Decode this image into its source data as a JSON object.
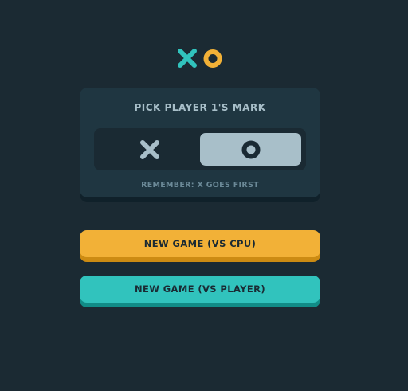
{
  "logo": {
    "x_icon": "x-mark-icon",
    "o_icon": "o-mark-icon",
    "x_color": "#31c3bd",
    "o_color": "#f2b137"
  },
  "mark_picker": {
    "title": "PICK PLAYER 1'S MARK",
    "options": [
      {
        "mark": "X",
        "icon": "x-mark-icon",
        "selected": false
      },
      {
        "mark": "O",
        "icon": "o-mark-icon",
        "selected": true
      }
    ],
    "note": "REMEMBER: X GOES FIRST"
  },
  "buttons": {
    "new_game_cpu": "NEW GAME (VS CPU)",
    "new_game_player": "NEW GAME (VS PLAYER)"
  },
  "colors": {
    "background": "#1b2a33",
    "panel": "#1f3641",
    "silver": "#a8bfc9",
    "yellow": "#f2b137",
    "teal": "#31c3bd"
  }
}
